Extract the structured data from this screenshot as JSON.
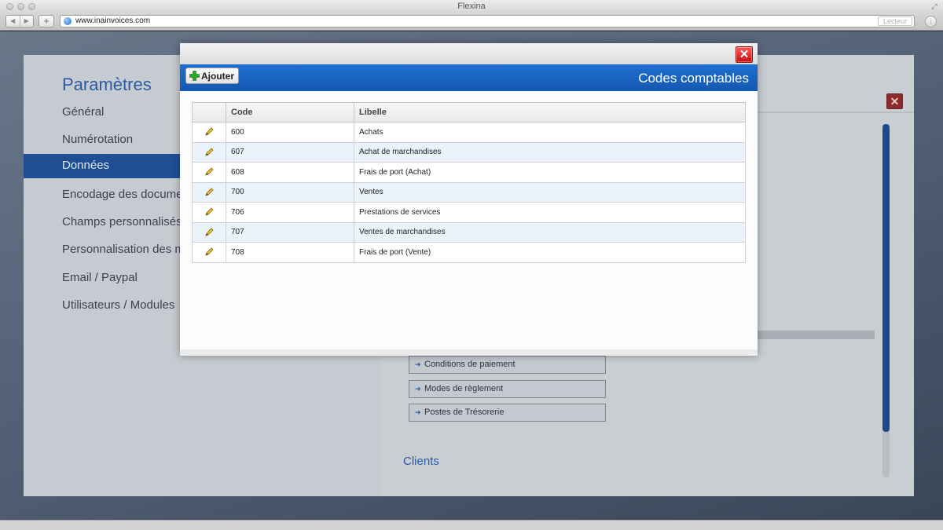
{
  "browser": {
    "window_title": "Flexina",
    "url": "www.inainvoices.com",
    "reader_label": "Lecteur"
  },
  "settings": {
    "title": "Paramètres",
    "menu": [
      {
        "label": "Général"
      },
      {
        "label": "Numérotation"
      },
      {
        "label": "Données",
        "active": true
      },
      {
        "label": "Encodage des documents"
      },
      {
        "label": "Champs personnalisés"
      },
      {
        "label": "Personnalisation des mails"
      },
      {
        "label": "Email / Paypal"
      },
      {
        "label": "Utilisateurs / Modules"
      }
    ],
    "buttons": [
      {
        "label": "Conditions de paiement"
      },
      {
        "label": "Modes de règlement"
      },
      {
        "label": "Postes de Trésorerie"
      }
    ],
    "section_title": "Clients"
  },
  "modal": {
    "title": "Codes comptables",
    "add_label": "Ajouter",
    "columns": {
      "code": "Code",
      "libelle": "Libelle"
    },
    "rows": [
      {
        "code": "600",
        "libelle": "Achats"
      },
      {
        "code": "607",
        "libelle": "Achat de marchandises"
      },
      {
        "code": "608",
        "libelle": "Frais de port (Achat)"
      },
      {
        "code": "700",
        "libelle": "Ventes"
      },
      {
        "code": "706",
        "libelle": "Prestations de services"
      },
      {
        "code": "707",
        "libelle": "Ventes de marchandises"
      },
      {
        "code": "708",
        "libelle": "Frais de port (Vente)"
      }
    ]
  },
  "icons": {
    "close": "close-icon",
    "edit": "pencil-icon",
    "add": "plus-icon",
    "arrow": "arrow-right-icon",
    "globe": "globe-icon"
  },
  "colors": {
    "header_blue": "#1458b1",
    "accent_blue": "#2a5aa0",
    "close_red": "#c40f0f",
    "row_alt": "#eaf3fc",
    "add_green": "#31a32d"
  }
}
